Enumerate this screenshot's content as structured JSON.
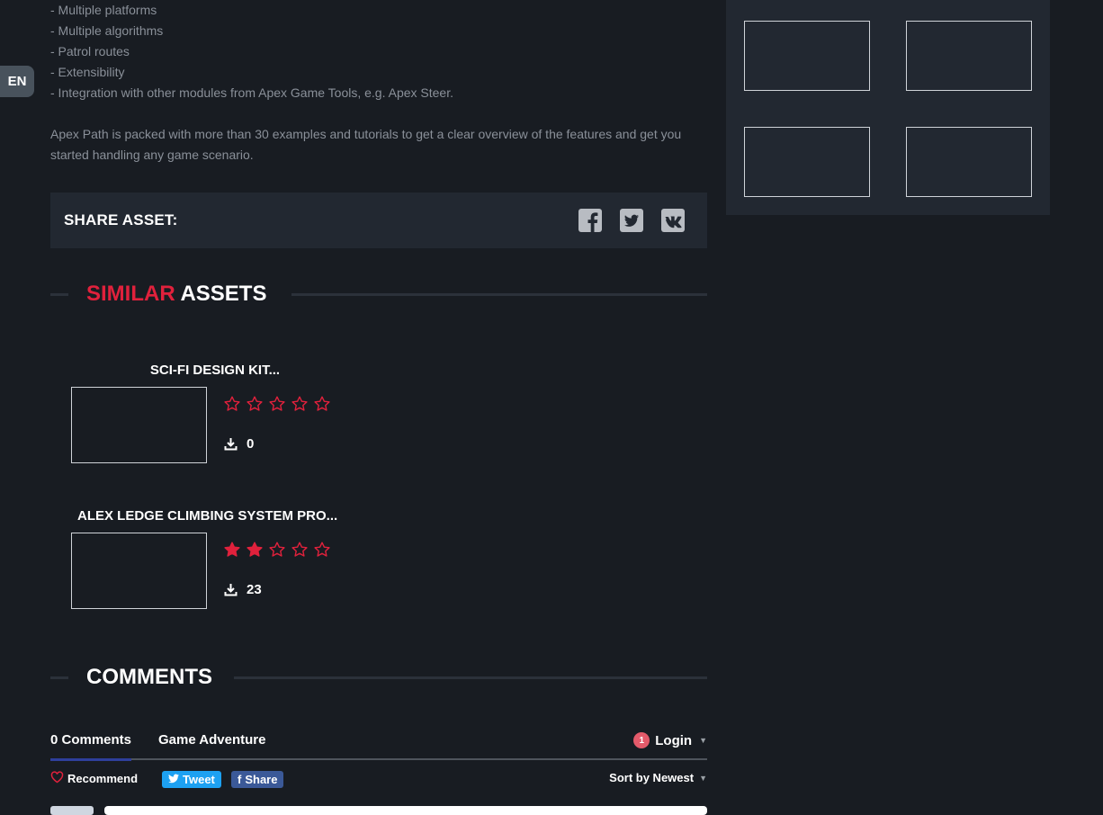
{
  "language": "EN",
  "description": {
    "features": [
      "- Multiple platforms",
      "- Multiple algorithms",
      "- Patrol routes",
      "- Extensibility",
      "- Integration with other modules from Apex Game Tools, e.g. Apex Steer."
    ],
    "paragraph": "Apex Path is packed with more than 30 examples and tutorials to get a clear overview of the features and get you started handling any game scenario."
  },
  "share": {
    "label": "SHARE ASSET:",
    "icons": [
      "facebook-icon",
      "twitter-icon",
      "vk-icon"
    ]
  },
  "similar": {
    "title_accent": "SIMILAR",
    "title_rest": " ASSETS",
    "items": [
      {
        "name": "SCI-FI DESIGN KIT...",
        "rating": 0,
        "rating_max": 5,
        "downloads": "0"
      },
      {
        "name": "ALEX LEDGE CLIMBING SYSTEM PRO...",
        "rating": 2,
        "rating_max": 5,
        "downloads": "23"
      }
    ]
  },
  "comments": {
    "title": "COMMENTS",
    "tabs": [
      "0 Comments",
      "Game Adventure"
    ],
    "login_badge": "1",
    "login_label": "Login",
    "recommend_label": "Recommend",
    "tweet_label": "Tweet",
    "share_label": "Share",
    "sort_label": "Sort by Newest"
  },
  "colors": {
    "background": "#181c22",
    "panel": "#222831",
    "accent_red": "#e0213c",
    "tweet_blue": "#1da1f2",
    "facebook_blue": "#3b5998"
  }
}
